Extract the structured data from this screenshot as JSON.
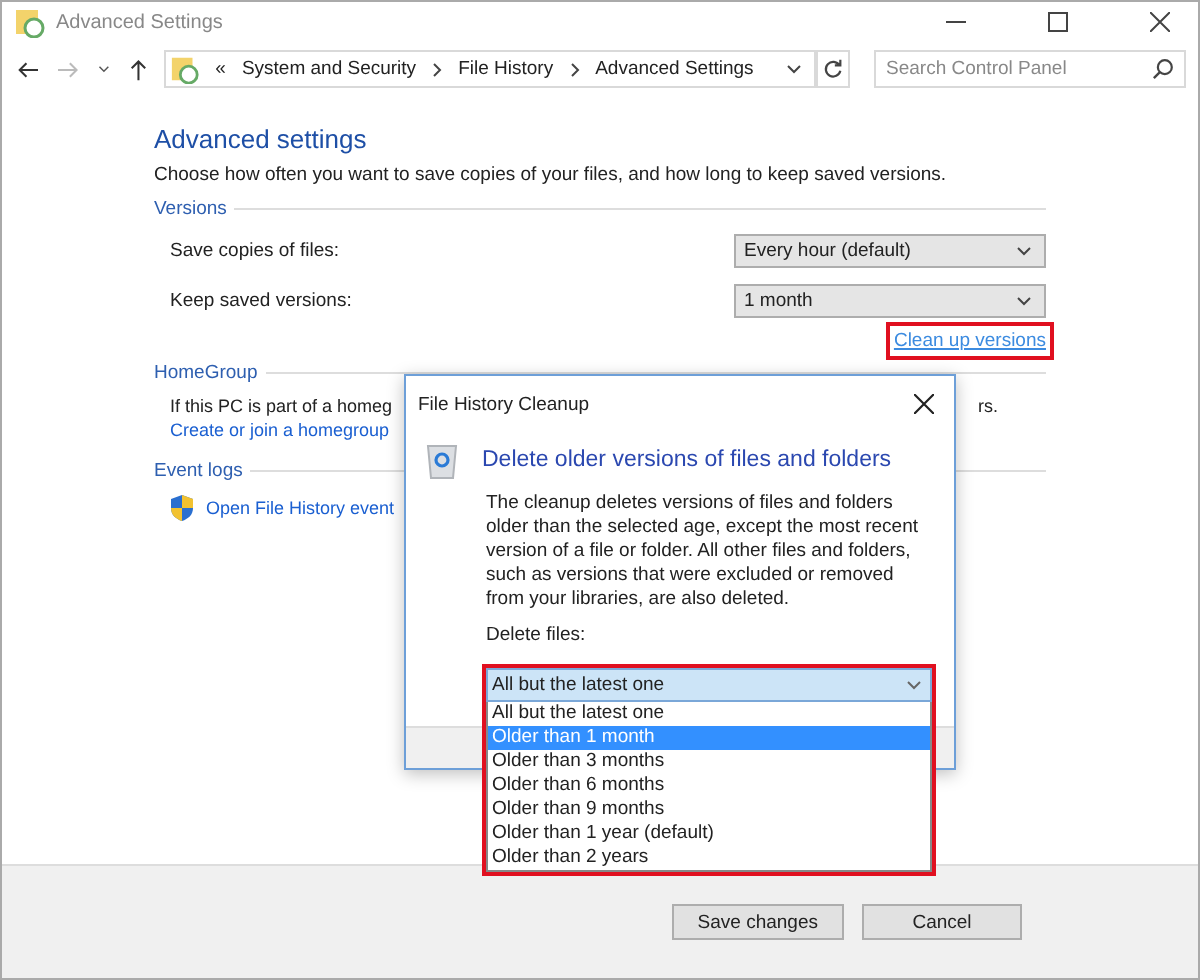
{
  "window": {
    "title": "Advanced Settings"
  },
  "address_bar": {
    "overflow": "«",
    "crumbs": [
      "System and Security",
      "File History",
      "Advanced Settings"
    ]
  },
  "search": {
    "placeholder": "Search Control Panel"
  },
  "page": {
    "heading": "Advanced settings",
    "intro": "Choose how often you want to save copies of your files, and how long to keep saved versions."
  },
  "versions": {
    "title": "Versions",
    "settings": [
      {
        "label": "Save copies of files:",
        "value": "Every hour (default)"
      },
      {
        "label": "Keep saved versions:",
        "value": "1 month"
      }
    ],
    "link": "Clean up versions"
  },
  "homegroup": {
    "title": "HomeGroup",
    "text_start": "If this PC is part of a homeg",
    "text_end": "rs.",
    "link": "Create or join a homegroup"
  },
  "event_logs": {
    "title": "Event logs",
    "link": "Open File History event"
  },
  "buttons": [
    "Save changes",
    "Cancel"
  ],
  "dialog": {
    "title": "File History Cleanup",
    "heading": "Delete older versions of files and folders",
    "body": "The cleanup deletes versions of files and folders older than the selected age, except the most recent version of a file or folder. All other files and folders, such as versions that were excluded or removed from your libraries, are also deleted.",
    "label": "Delete files:",
    "select_value": "All but the latest one",
    "options": [
      {
        "label": "All but the latest one",
        "selected": false
      },
      {
        "label": "Older than 1 month",
        "selected": true
      },
      {
        "label": "Older than 3 months",
        "selected": false
      },
      {
        "label": "Older than 6 months",
        "selected": false
      },
      {
        "label": "Older than 9 months",
        "selected": false
      },
      {
        "label": "Older than 1 year (default)",
        "selected": false
      },
      {
        "label": "Older than 2 years",
        "selected": false
      }
    ]
  }
}
